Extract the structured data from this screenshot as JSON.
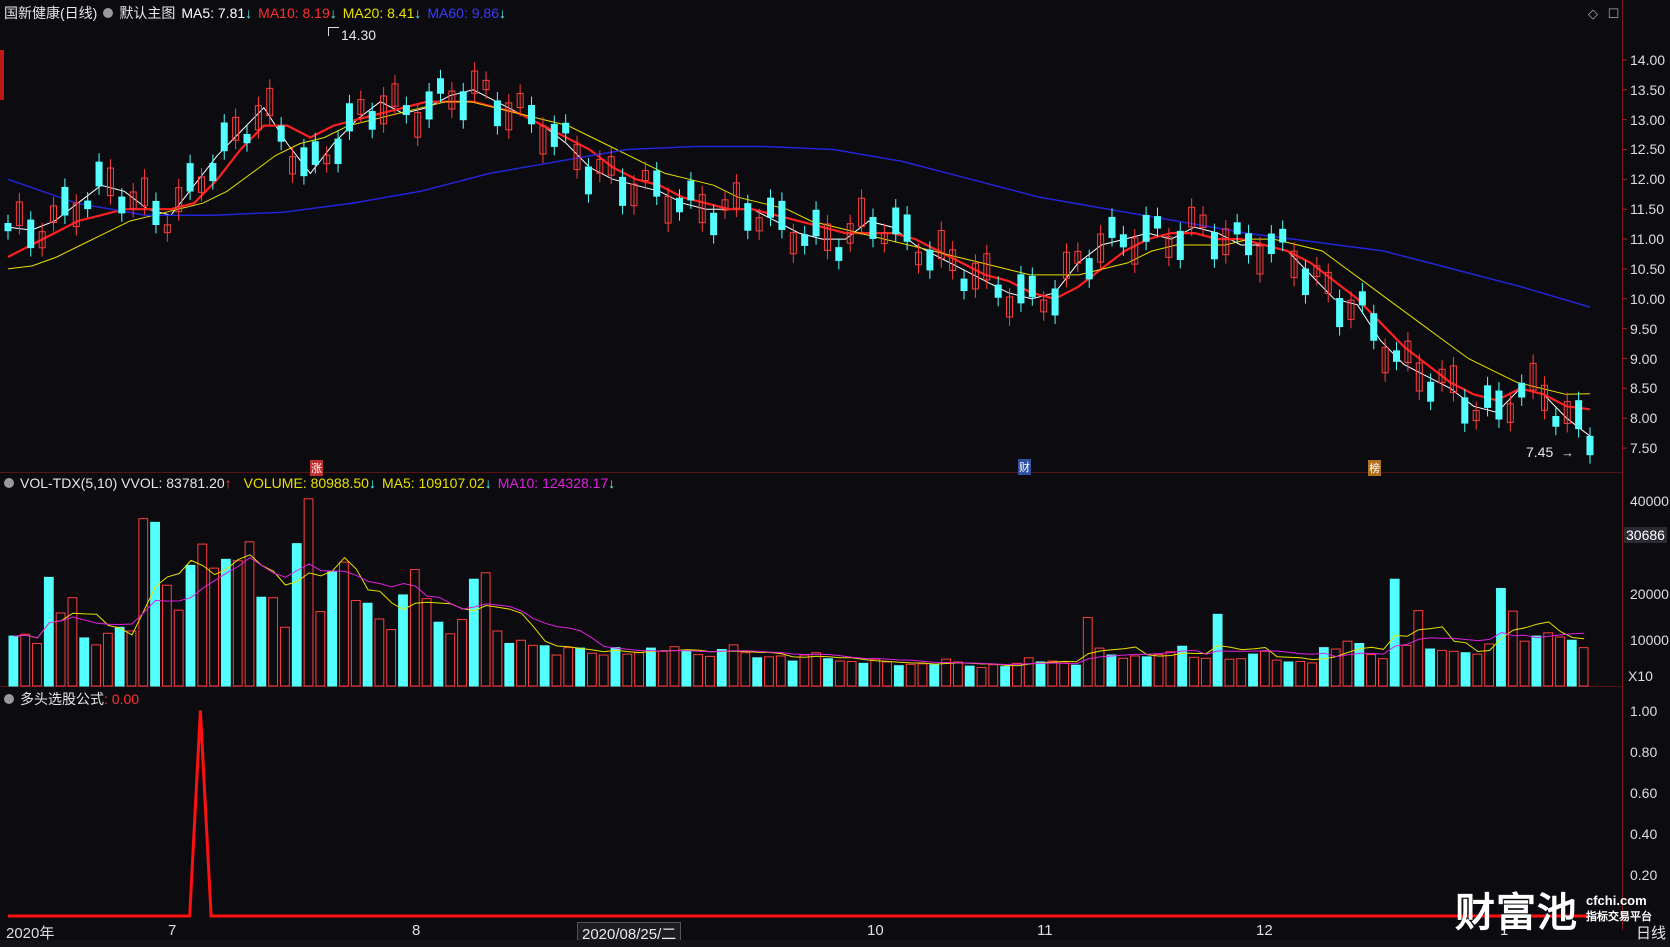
{
  "header": {
    "stock": "国新健康(日线)",
    "template": "默认主图",
    "ma5": "MA5: 7.81",
    "ma10": "MA10: 8.19",
    "ma20": "MA20: 8.41",
    "ma60": "MA60: 9.86",
    "arrow": "↓"
  },
  "vol_header": {
    "name": "VOL-TDX(5,10) VVOL: 83781.20",
    "up_arrow": "↑",
    "volume": "VOLUME: 80988.50",
    "ma5": "MA5: 109107.02",
    "ma10": "MA10: 124328.17",
    "arrow": "↓"
  },
  "ind_header": {
    "name": "多头选股公式",
    "value": ": 0.00"
  },
  "annotations": {
    "high": "14.30",
    "low": "7.45",
    "m1": "涨",
    "m2": "财",
    "m3": "榜"
  },
  "vol_box": "30686",
  "vol_multiplier": "X10",
  "cursor_date": "2020/08/25/二",
  "period_label": "日线",
  "logo": {
    "big": "财富池",
    "domain": "cfchi.com",
    "tag": "指标交易平台"
  },
  "colors": {
    "ma5": "#ffffff",
    "ma10": "#ff2020",
    "ma20": "#e8e000",
    "ma60": "#2424d8",
    "up": "#ff3d3d",
    "down": "#54ffff",
    "signal": "#ff1010"
  },
  "chart_data": [
    {
      "type": "line",
      "title": "国新健康(日线)",
      "ylim": [
        7.2,
        14.4
      ],
      "price_ticks": [
        "14.00",
        "13.50",
        "13.00",
        "12.50",
        "12.00",
        "11.50",
        "11.00",
        "10.50",
        "10.00",
        "9.50",
        "9.00",
        "8.50",
        "8.00",
        "7.50"
      ],
      "x_ticks": [
        "2020年",
        "7",
        "8",
        "10",
        "11",
        "12",
        "1"
      ],
      "series": [
        {
          "name": "MA5",
          "values": [
            11.2,
            11.15,
            11.3,
            11.6,
            11.9,
            11.8,
            11.5,
            11.4,
            11.9,
            12.4,
            12.8,
            13.2,
            12.6,
            12.1,
            12.6,
            13.0,
            13.3,
            13.1,
            13.2,
            13.4,
            13.5,
            13.3,
            13.1,
            12.9,
            12.6,
            12.2,
            12.0,
            11.9,
            11.8,
            11.6,
            11.5,
            11.5,
            11.5,
            11.3,
            11.1,
            11.0,
            11.0,
            11.3,
            11.2,
            10.9,
            10.7,
            10.5,
            10.3,
            10.1,
            10.0,
            10.1,
            10.6,
            10.9,
            11.0,
            11.1,
            11.0,
            11.2,
            11.1,
            10.9,
            10.9,
            10.8,
            10.4,
            10.0,
            9.9,
            9.3,
            8.9,
            8.7,
            8.5,
            8.2,
            8.1,
            8.5,
            8.4,
            8.0,
            7.7
          ]
        },
        {
          "name": "MA10",
          "values": [
            10.7,
            10.9,
            11.1,
            11.3,
            11.4,
            11.5,
            11.5,
            11.5,
            11.6,
            12.0,
            12.5,
            12.9,
            12.9,
            12.7,
            12.9,
            13.0,
            13.1,
            13.2,
            13.3,
            13.3,
            13.3,
            13.2,
            13.1,
            12.9,
            12.7,
            12.5,
            12.2,
            12.0,
            11.9,
            11.7,
            11.6,
            11.5,
            11.5,
            11.4,
            11.3,
            11.2,
            11.1,
            11.1,
            11.1,
            11.0,
            10.8,
            10.6,
            10.4,
            10.3,
            10.1,
            10.0,
            10.2,
            10.5,
            10.8,
            11.0,
            11.1,
            11.1,
            11.0,
            11.0,
            10.9,
            10.8,
            10.6,
            10.3,
            10.0,
            9.6,
            9.2,
            8.9,
            8.6,
            8.4,
            8.3,
            8.5,
            8.4,
            8.2,
            8.15
          ]
        },
        {
          "name": "MA20",
          "values": [
            10.5,
            10.55,
            10.7,
            10.9,
            11.1,
            11.3,
            11.4,
            11.5,
            11.6,
            11.8,
            12.1,
            12.4,
            12.6,
            12.7,
            12.9,
            13.0,
            13.1,
            13.2,
            13.3,
            13.3,
            13.2,
            13.1,
            13.0,
            12.9,
            12.7,
            12.5,
            12.3,
            12.1,
            12.0,
            11.9,
            11.7,
            11.6,
            11.5,
            11.3,
            11.2,
            11.1,
            11.0,
            10.9,
            10.8,
            10.7,
            10.6,
            10.5,
            10.4,
            10.4,
            10.4,
            10.5,
            10.6,
            10.8,
            10.9,
            10.9,
            10.9,
            11.0,
            11.0,
            10.9,
            10.8,
            10.5,
            10.2,
            9.9,
            9.6,
            9.3,
            9.0,
            8.8,
            8.6,
            8.5,
            8.4,
            8.41
          ]
        },
        {
          "name": "MA60",
          "values": [
            12.0,
            11.6,
            11.4,
            11.4,
            11.45,
            11.6,
            11.8,
            12.1,
            12.3,
            12.5,
            12.55,
            12.55,
            12.5,
            12.3,
            12.0,
            11.7,
            11.5,
            11.3,
            11.1,
            10.95,
            10.8,
            10.5,
            10.2,
            9.86
          ]
        }
      ]
    },
    {
      "type": "bar",
      "title": "VOL-TDX(5,10)",
      "ylim": [
        0,
        45000
      ],
      "y_ticks": [
        "40000",
        "30686",
        "20000",
        "10000",
        "X10"
      ],
      "values": [
        10800,
        11200,
        9200,
        23500,
        15800,
        19100,
        10400,
        8900,
        11400,
        12700,
        11900,
        36200,
        35400,
        21800,
        16400,
        26100,
        30700,
        25500,
        27400,
        27100,
        31200,
        19200,
        19100,
        12700,
        30800,
        40500,
        16100,
        24700,
        26800,
        18500,
        17900,
        14500,
        12200,
        19700,
        25200,
        18900,
        13800,
        11300,
        14400,
        23100,
        24500,
        11900,
        9200,
        9900,
        8800,
        8700,
        6700,
        8300,
        8200,
        7100,
        6700,
        8300,
        6900,
        7200,
        8200,
        7500,
        8500,
        7800,
        6800,
        6400,
        7900,
        8900,
        7200,
        6100,
        6300,
        6500,
        5400,
        6700,
        7200,
        5900,
        5400,
        5300,
        4900,
        5800,
        5200,
        4400,
        4700,
        4800,
        4600,
        5800,
        5200,
        4300,
        4000,
        4600,
        4200,
        4900,
        6100,
        5200,
        5400,
        5000,
        4500,
        14800,
        8200,
        6700,
        6000,
        6500,
        6300,
        6800,
        7400,
        8600,
        6200,
        6000,
        15500,
        5800,
        5900,
        6900,
        7500,
        5600,
        5200,
        5300,
        5000,
        8300,
        8000,
        9700,
        9200,
        6800,
        5900,
        23100,
        8800,
        16300,
        8000,
        7700,
        7500,
        7200,
        6900,
        9100,
        21100,
        16200,
        9700,
        10800,
        11500,
        10600,
        9900,
        8300
      ]
    },
    {
      "type": "line",
      "title": "多头选股公式",
      "ylim": [
        0,
        1.1
      ],
      "y_ticks": [
        "1.00",
        "0.80",
        "0.60",
        "0.40",
        "0.20"
      ],
      "values": [
        0,
        0,
        0,
        0,
        0,
        0,
        0,
        0,
        0,
        0,
        0,
        0,
        0,
        0,
        0,
        0,
        0,
        0,
        1,
        0,
        0,
        0,
        0,
        0,
        0,
        0,
        0,
        0,
        0,
        0,
        0,
        0,
        0,
        0,
        0,
        0,
        0,
        0,
        0,
        0,
        0,
        0,
        0,
        0,
        0,
        0,
        0,
        0,
        0,
        0,
        0,
        0,
        0,
        0,
        0,
        0,
        0,
        0,
        0,
        0,
        0,
        0,
        0,
        0,
        0,
        0,
        0,
        0,
        0,
        0,
        0,
        0,
        0,
        0,
        0,
        0,
        0,
        0,
        0,
        0,
        0,
        0,
        0,
        0,
        0,
        0,
        0,
        0,
        0,
        0,
        0,
        0,
        0,
        0,
        0,
        0,
        0,
        0,
        0,
        0,
        0,
        0,
        0,
        0,
        0,
        0,
        0,
        0,
        0,
        0,
        0,
        0,
        0,
        0,
        0,
        0,
        0,
        0,
        0,
        0,
        0,
        0,
        0,
        0,
        0,
        0,
        0,
        0,
        0,
        0,
        0,
        0,
        0,
        0,
        0,
        0,
        0,
        0,
        0,
        0,
        0,
        0,
        0,
        0,
        0,
        0,
        0,
        0,
        0
      ]
    }
  ]
}
